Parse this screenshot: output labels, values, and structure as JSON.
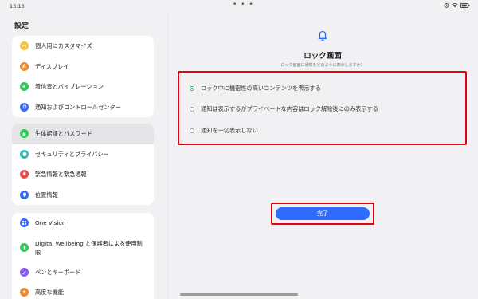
{
  "status": {
    "time": "13:13",
    "center_dots": "• • •"
  },
  "sidebar": {
    "title": "設定",
    "groups": [
      {
        "items": [
          {
            "label": "個人用にカスタマイズ",
            "icon": "palette-icon",
            "color": "#f5c542"
          },
          {
            "label": "ディスプレイ",
            "icon": "display-icon",
            "color": "#f08a2b"
          },
          {
            "label": "着信音とバイブレーション",
            "icon": "sound-icon",
            "color": "#34c759"
          },
          {
            "label": "通知およびコントロールセンター",
            "icon": "notification-icon",
            "color": "#2f6bff"
          }
        ]
      },
      {
        "items": [
          {
            "label": "生体認証とパスワード",
            "icon": "biometric-icon",
            "color": "#34c759"
          },
          {
            "label": "セキュリティとプライバシー",
            "icon": "shield-icon",
            "color": "#2fb8b0"
          },
          {
            "label": "緊急情報と緊急通報",
            "icon": "emergency-icon",
            "color": "#f04848"
          },
          {
            "label": "位置情報",
            "icon": "location-icon",
            "color": "#2f6bff"
          }
        ]
      },
      {
        "items": [
          {
            "label": "One Vision",
            "icon": "one-vision-icon",
            "color": "#2f6bff"
          },
          {
            "label": "Digital Wellbeing と保護者による使用制限",
            "icon": "wellbeing-icon",
            "color": "#34c759"
          },
          {
            "label": "ペンとキーボード",
            "icon": "pen-icon",
            "color": "#8a5cf5"
          },
          {
            "label": "高度な機能",
            "icon": "advanced-icon",
            "color": "#f08a2b"
          }
        ]
      }
    ]
  },
  "main": {
    "icon": "bell-icon",
    "title": "ロック画面",
    "subtitle": "ロック画面に通知をどのように表示しますか？",
    "options": [
      {
        "label": "ロック中に機密性の高いコンテンツを表示する",
        "selected": true
      },
      {
        "label": "通知は表示するがプライベートな内容はロック解除後にのみ表示する",
        "selected": false
      },
      {
        "label": "通知を一切表示しない",
        "selected": false
      }
    ],
    "done_label": "完了"
  },
  "colors": {
    "accent": "#2f6bff",
    "radio_selected": "#29b36b",
    "highlight": "#e50012"
  }
}
